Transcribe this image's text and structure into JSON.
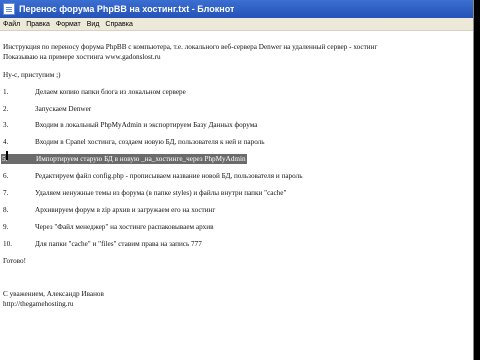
{
  "window": {
    "title": "Перенос форума PhpBB на хостинг.txt - Блокнот"
  },
  "menu": [
    "Файл",
    "Правка",
    "Формат",
    "Вид",
    "Справка"
  ],
  "document": {
    "intro_line1": "Инструкция по переносу форума PhpBB с компьютера, т.е. локального веб-сервера Denwer на удаленный сервер - хостинг",
    "intro_line2": "Показываю на примере хостинга www.gadonslost.ru",
    "greeting": "Ну-с, приступим ;)",
    "steps": [
      {
        "num": "1.",
        "text": "Делаем копию папки блога из локальном сервере"
      },
      {
        "num": "2.",
        "text": "Запускаем Denwer"
      },
      {
        "num": "3.",
        "text": "Входим в локальный PhpMyAdmin и экспортируем Базу Данных форума"
      },
      {
        "num": "4.",
        "text": "Входим в Cpanel хостинга, создаем новую БД, пользователя к ней и пароль"
      },
      {
        "num": "5.",
        "text": "Импортируем старую БД в новую _на_хостинге_через PhpMyAdmin"
      },
      {
        "num": "6.",
        "text": "Редактируем файл config.php - прописываем название новой БД, пользователя и пароль"
      },
      {
        "num": "7.",
        "text": "Удаляем ненужные темы из форума (в папке styles) и файлы внутри папки \"cache\""
      },
      {
        "num": "8.",
        "text": "Архивируем форум в zip архив и загружаем его на хостинг"
      },
      {
        "num": "9.",
        "text": "Через \"Файл менеджер\" на хостинге распаковываем архив"
      },
      {
        "num": "10.",
        "text": "Для папки \"cache\" и \"files\" ставим права на запись 777"
      }
    ],
    "done": "Готово!",
    "sign1": "С уважением, Александр Иванов",
    "sign2": "http://thegamehosting.ru"
  }
}
